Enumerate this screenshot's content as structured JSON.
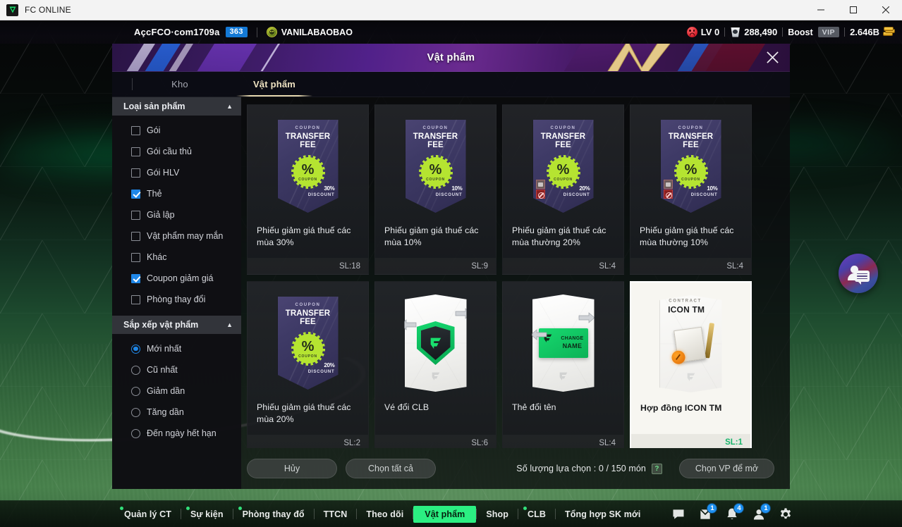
{
  "window": {
    "app_title": "FC ONLINE",
    "controls": {
      "minimize": "minimize-button",
      "maximize": "maximize-button",
      "close": "close-button"
    }
  },
  "hud": {
    "username": "AçcFCO·com1709a",
    "level_badge": "363",
    "guild": "VANILABAOBAO",
    "lv_label": "LV 0",
    "energy": "288,490",
    "boost_label": "Boost",
    "vip_label": "VIP",
    "currency": "2.646B"
  },
  "panel": {
    "banner_title": "Vật phẩm",
    "close_label": "×",
    "tabs": [
      {
        "label": "Kho",
        "active": false
      },
      {
        "label": "Vật phẩm",
        "active": true
      }
    ]
  },
  "sidebar": {
    "sections": [
      {
        "title": "Loại sản phẩm",
        "collapsed": false,
        "type": "checkbox",
        "items": [
          {
            "label": "Gói",
            "checked": false
          },
          {
            "label": "Gói cầu thủ",
            "checked": false
          },
          {
            "label": "Gói HLV",
            "checked": false
          },
          {
            "label": "Thẻ",
            "checked": true
          },
          {
            "label": "Giả lập",
            "checked": false
          },
          {
            "label": "Vật phẩm may mắn",
            "checked": false
          },
          {
            "label": "Khác",
            "checked": false
          },
          {
            "label": "Coupon giảm giá",
            "checked": true
          },
          {
            "label": "Phòng thay đổi",
            "checked": false
          }
        ]
      },
      {
        "title": "Sắp xếp vật phẩm",
        "collapsed": false,
        "type": "radio",
        "items": [
          {
            "label": "Mới nhất",
            "checked": true
          },
          {
            "label": "Cũ nhất",
            "checked": false
          },
          {
            "label": "Giảm dần",
            "checked": false
          },
          {
            "label": "Tăng dần",
            "checked": false
          },
          {
            "label": "Đến ngày hết hạn",
            "checked": false
          }
        ]
      }
    ]
  },
  "items": [
    {
      "art": "coupon",
      "selected": false,
      "coupon_sub": "COUPON",
      "coupon_title": "TRANSFER FEE",
      "seal_pct": "%",
      "seal_label": "COUPON",
      "discount": "30",
      "discount_unit": "%",
      "discount_label": "DISCOUNT",
      "flags": false,
      "name": "Phiếu giảm giá thuế các mùa 30%",
      "qty": "SL:18"
    },
    {
      "art": "coupon",
      "selected": false,
      "coupon_sub": "COUPON",
      "coupon_title": "TRANSFER FEE",
      "seal_pct": "%",
      "seal_label": "COUPON",
      "discount": "10",
      "discount_unit": "%",
      "discount_label": "DISCOUNT",
      "flags": false,
      "name": "Phiếu giảm giá thuế các mùa 10%",
      "qty": "SL:9"
    },
    {
      "art": "coupon",
      "selected": false,
      "coupon_sub": "COUPON",
      "coupon_title": "TRANSFER FEE",
      "seal_pct": "%",
      "seal_label": "COUPON",
      "discount": "20",
      "discount_unit": "%",
      "discount_label": "DISCOUNT",
      "flags": true,
      "name": "Phiếu giảm giá thuế các mùa thường 20%",
      "qty": "SL:4"
    },
    {
      "art": "coupon",
      "selected": false,
      "coupon_sub": "COUPON",
      "coupon_title": "TRANSFER FEE",
      "seal_pct": "%",
      "seal_label": "COUPON",
      "discount": "10",
      "discount_unit": "%",
      "discount_label": "DISCOUNT",
      "flags": true,
      "name": "Phiếu giảm giá thuế các mùa thường 10%",
      "qty": "SL:4"
    },
    {
      "art": "coupon",
      "selected": false,
      "coupon_sub": "COUPON",
      "coupon_title": "TRANSFER FEE",
      "seal_pct": "%",
      "seal_label": "COUPON",
      "discount": "20",
      "discount_unit": "%",
      "discount_label": "DISCOUNT",
      "flags": false,
      "name": "Phiếu giảm giá thuế các mùa 20%",
      "qty": "SL:2"
    },
    {
      "art": "club-ticket",
      "selected": false,
      "name": "Vé đổi CLB",
      "qty": "SL:6"
    },
    {
      "art": "name-change",
      "selected": false,
      "namecard_line1": "CHANGE",
      "namecard_line2": "NAME",
      "name": "Thẻ đổi tên",
      "qty": "SL:4"
    },
    {
      "art": "contract",
      "selected": true,
      "contract_sub": "CONTRACT",
      "contract_title": "ICON TM",
      "name": "Hợp đồng ICON TM",
      "qty": "SL:1"
    }
  ],
  "actions": {
    "cancel_label": "Hủy",
    "select_all_label": "Chọn tất cả",
    "selection_text": "Số lượng lựa chọn : 0 / 150 món",
    "help_label": "?",
    "open_label": "Chọn VP để mở"
  },
  "bottom_nav": {
    "items": [
      {
        "label": "Quản lý CT",
        "dot": true,
        "active": false
      },
      {
        "label": "Sự kiện",
        "dot": true,
        "active": false
      },
      {
        "label": "Phòng thay đổ",
        "dot": true,
        "active": false
      },
      {
        "label": "TTCN",
        "dot": false,
        "active": false
      },
      {
        "label": "Theo dõi",
        "dot": false,
        "active": false
      },
      {
        "label": "Vật phẩm",
        "dot": false,
        "active": true
      },
      {
        "label": "Shop",
        "dot": false,
        "active": false
      },
      {
        "label": "CLB",
        "dot": true,
        "active": false
      },
      {
        "label": "Tổng hợp SK mới",
        "dot": false,
        "active": false
      }
    ],
    "icons": [
      {
        "name": "chat-icon",
        "badge": ""
      },
      {
        "name": "mail-icon",
        "badge": "1"
      },
      {
        "name": "bell-icon",
        "badge": "4"
      },
      {
        "name": "friends-icon",
        "badge": "1"
      },
      {
        "name": "settings-icon",
        "badge": ""
      }
    ]
  },
  "float_button": {
    "name": "friend-chat-button"
  },
  "colors": {
    "accent_green": "#2bef82",
    "checkbox_blue": "#1f87e8",
    "badge_blue": "#1d8ff0",
    "tab_active": "#efe3c2"
  }
}
